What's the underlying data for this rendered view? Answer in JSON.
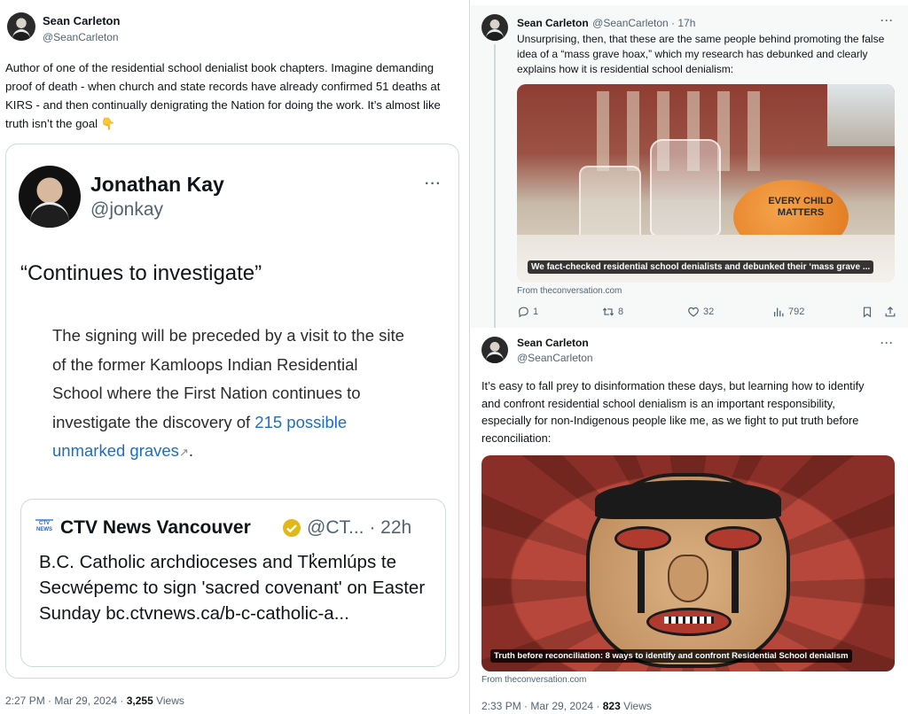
{
  "left_tweet": {
    "author_name": "Sean Carleton",
    "author_handle": "@SeanCarleton",
    "text": "Author of one of the residential school denialist book chapters. Imagine demanding proof of death - when church and state records have already confirmed 51 deaths at KIRS - and then continually denigrating the Nation for doing the work. It’s almost like truth isn’t the goal 👇",
    "quoted": {
      "author_name": "Jonathan Kay",
      "author_handle": "@jonkay",
      "headline": "“Continues to investigate”",
      "excerpt": "The signing will be preceded by a visit to the site of the former Kamloops Indian Residential School where the First Nation continues to investigate the discovery of",
      "excerpt_link": "215 possible unmarked graves",
      "excerpt_end": ".",
      "inner": {
        "source_logo": "CTV NEWS",
        "author_name": "CTV News Vancouver",
        "author_handle_time": "@CT... · 22h",
        "text": "B.C. Catholic archdioceses and Tk̓emlúps te Secwépemc to sign 'sacred covenant' on Easter Sunday bc.ctvnews.ca/b-c-catholic-a..."
      }
    },
    "time": "2:27 PM · Mar 29, 2024 · ",
    "views_count": "3,255",
    "views_label": " Views"
  },
  "right_top_tweet": {
    "author_name": "Sean Carleton",
    "author_handle_time": "@SeanCarleton · 17h",
    "text": "Unsurprising, then, that these are the same people behind promoting the false idea of a “mass grave hoax,” which my research has debunked and clearly explains how it is residential school denialism:",
    "card_caption": "We fact-checked residential school denialists and debunked their ‘mass grave ...",
    "card_source": "From theconversation.com",
    "rock_text": "EVERY CHILD MATTERS",
    "actions": {
      "replies": "1",
      "retweets": "8",
      "likes": "32",
      "views": "792"
    }
  },
  "right_bottom_tweet": {
    "author_name": "Sean Carleton",
    "author_handle": "@SeanCarleton",
    "text": "It’s easy to fall prey to disinformation these days, but learning how to identify and confront residential school denialism is an important responsibility, especially for non-Indigenous people like me, as we fight to put truth before reconciliation:",
    "card_caption": "Truth before reconciliation: 8 ways to identify and confront Residential School denialism",
    "card_source": "From theconversation.com",
    "time": "2:33 PM · Mar 29, 2024 · ",
    "views_count": "823",
    "views_label": " Views"
  },
  "colors": {
    "text": "#0f1419",
    "muted": "#536471",
    "link": "#1d9bf0",
    "border": "#cfd9de",
    "verified_gold": "#e2b719"
  }
}
